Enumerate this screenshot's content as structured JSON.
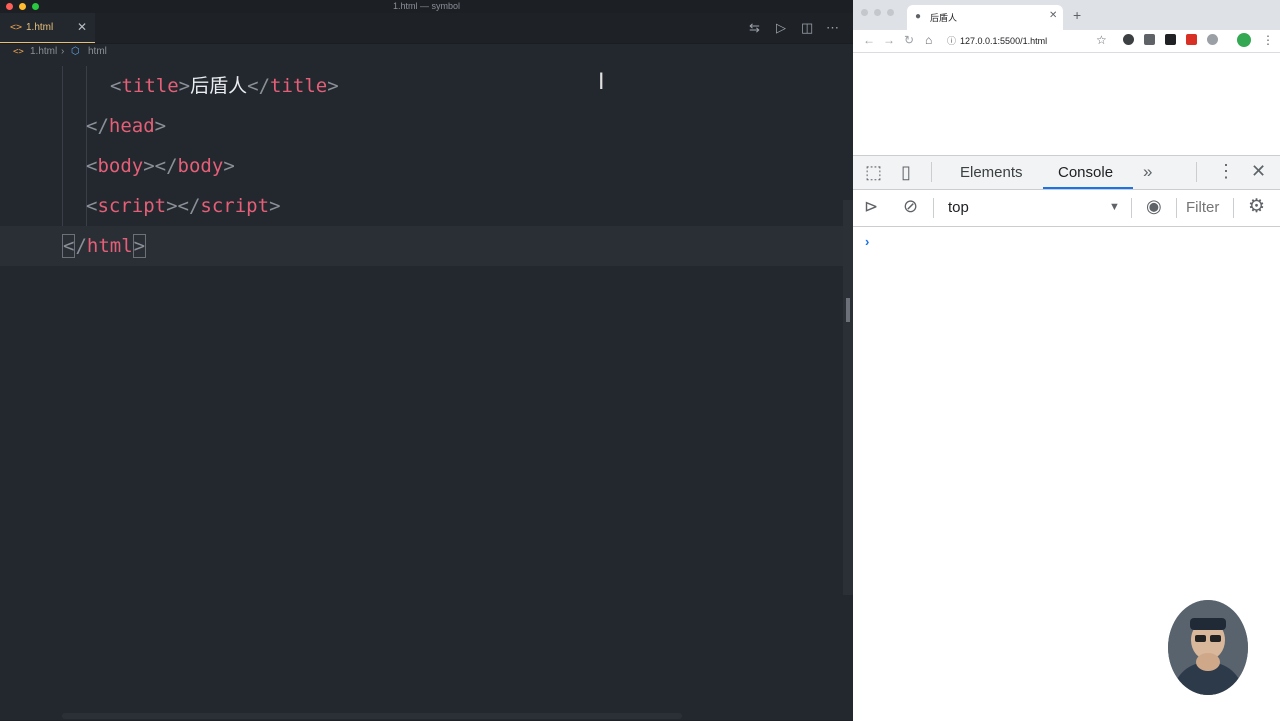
{
  "editor": {
    "window_title": "1.html — symbol",
    "tab": {
      "icon": "html-file-icon",
      "label": "1.html"
    },
    "breadcrumb": {
      "file": "1.html",
      "node": "html"
    },
    "code": {
      "line1": {
        "open_tag": "title",
        "text": "后盾人",
        "close_tag": "title"
      },
      "line2": {
        "close_tag": "head"
      },
      "line3": {
        "open_tag": "body",
        "close_tag": "body"
      },
      "line4": {
        "open_tag": "script",
        "close_tag": "script"
      },
      "line5": {
        "close_tag": "html"
      }
    }
  },
  "browser": {
    "tab_title": "后盾人",
    "url": "127.0.0.1:5500/1.html",
    "devtools": {
      "tabs": {
        "elements": "Elements",
        "console": "Console"
      },
      "active_tab": "Console",
      "context": "top",
      "filter_placeholder": "Filter",
      "prompt": "›"
    }
  },
  "colors": {
    "tag": "#e45f77",
    "accent": "#1a73e8",
    "editor_bg": "#23272e"
  }
}
